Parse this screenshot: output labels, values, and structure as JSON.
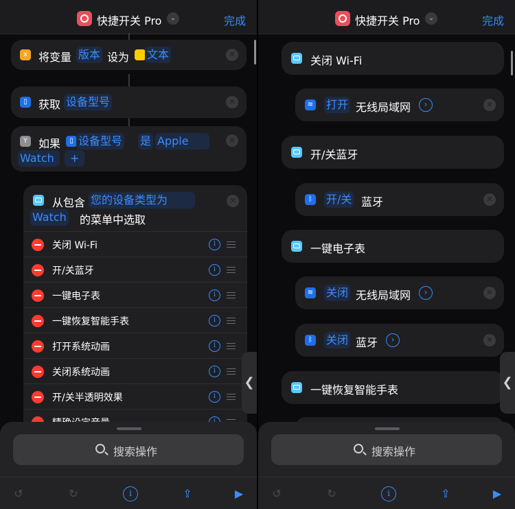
{
  "left": {
    "header": {
      "title": "快捷开关 Pro",
      "done": "完成"
    },
    "rows": {
      "set_var": {
        "label": "将变量",
        "token1": "版本",
        "mid": "设为",
        "token2": "文本"
      },
      "get": {
        "label": "获取",
        "token": "设备型号"
      },
      "if": {
        "label": "如果",
        "token1": "设备型号",
        "op": "是",
        "value_line1": "Apple",
        "value_line2": "Watch",
        "add": "+"
      },
      "menu": {
        "label": "从包含",
        "token": "您的设备类型为",
        "token2": "Watch",
        "suffix": "的菜单中选取"
      }
    },
    "menu_items": [
      "关闭 Wi-Fi",
      "开/关蓝牙",
      "一键电子表",
      "一键恢复智能手表",
      "打开系统动画",
      "关闭系统动画",
      "开/关半透明效果",
      "精确设定音量"
    ],
    "search": "搜索操作"
  },
  "right": {
    "header": {
      "title": "快捷开关 Pro",
      "done": "完成"
    },
    "items": [
      {
        "label": "关闭 Wi-Fi"
      },
      {
        "token": "打开",
        "text": "无线局域网"
      },
      {
        "label": "开/关蓝牙"
      },
      {
        "token": "开/关",
        "text": "蓝牙"
      },
      {
        "label": "一键电子表"
      },
      {
        "token": "关闭",
        "text": "无线局域网"
      },
      {
        "token": "关闭",
        "text": "蓝牙"
      },
      {
        "label": "一键恢复智能手表"
      }
    ],
    "search": "搜索操作"
  },
  "icons": {
    "undo": "undo-icon",
    "redo": "redo-icon",
    "info": "info-icon",
    "share": "share-icon",
    "play": "play-icon"
  },
  "colors": {
    "accent": "#3a8dff",
    "card": "#1f1f22",
    "delete": "#ff3b30",
    "app": "#e8505b"
  }
}
